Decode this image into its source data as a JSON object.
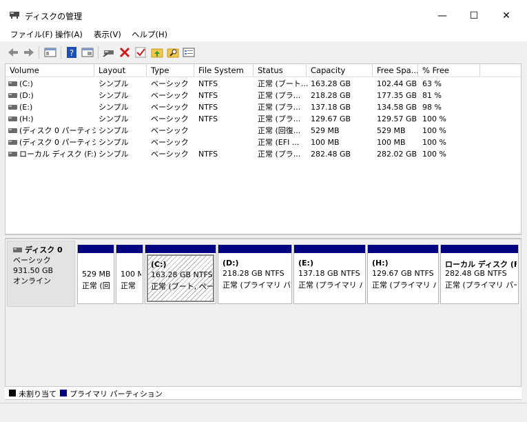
{
  "window": {
    "title": "ディスクの管理",
    "controls": {
      "minimize": "—",
      "maximize": "☐",
      "close": "✕"
    }
  },
  "menu": [
    "ファイル(F)",
    "操作(A)",
    "表示(V)",
    "ヘルプ(H)"
  ],
  "toolbar": {
    "icons": [
      "back-arrow-icon",
      "forward-arrow-icon",
      "console-tree-icon",
      "help-icon",
      "properties-icon",
      "connect-icon",
      "delete-icon",
      "check-icon",
      "folder-up-icon",
      "search-icon",
      "list-icon"
    ]
  },
  "columns": [
    "Volume",
    "Layout",
    "Type",
    "File System",
    "Status",
    "Capacity",
    "Free Spa...",
    "% Free"
  ],
  "volumes": [
    {
      "volume": "(C:)",
      "layout": "シンプル",
      "type": "ベーシック",
      "fs": "NTFS",
      "status": "正常 (ブート...",
      "capacity": "163.28 GB",
      "free": "102.44 GB",
      "pct": "63 %"
    },
    {
      "volume": "(D:)",
      "layout": "シンプル",
      "type": "ベーシック",
      "fs": "NTFS",
      "status": "正常 (プラ...",
      "capacity": "218.28 GB",
      "free": "177.35 GB",
      "pct": "81 %"
    },
    {
      "volume": "(E:)",
      "layout": "シンプル",
      "type": "ベーシック",
      "fs": "NTFS",
      "status": "正常 (プラ...",
      "capacity": "137.18 GB",
      "free": "134.58 GB",
      "pct": "98 %"
    },
    {
      "volume": "(H:)",
      "layout": "シンプル",
      "type": "ベーシック",
      "fs": "NTFS",
      "status": "正常 (プラ...",
      "capacity": "129.67 GB",
      "free": "129.57 GB",
      "pct": "100 %"
    },
    {
      "volume": "(ディスク 0 パーティシ...",
      "layout": "シンプル",
      "type": "ベーシック",
      "fs": "",
      "status": "正常 (回復...",
      "capacity": "529 MB",
      "free": "529 MB",
      "pct": "100 %"
    },
    {
      "volume": "(ディスク 0 パーティシ...",
      "layout": "シンプル",
      "type": "ベーシック",
      "fs": "",
      "status": "正常 (EFI ...",
      "capacity": "100 MB",
      "free": "100 MB",
      "pct": "100 %"
    },
    {
      "volume": "ローカル ディスク (F:)",
      "layout": "シンプル",
      "type": "ベーシック",
      "fs": "NTFS",
      "status": "正常 (プラ...",
      "capacity": "282.48 GB",
      "free": "282.02 GB",
      "pct": "100 %"
    }
  ],
  "disk": {
    "name": "ディスク 0",
    "type": "ベーシック",
    "size": "931.50 GB",
    "state": "オンライン"
  },
  "partitions": [
    {
      "title": "",
      "size": "529 MB",
      "status": "正常 (回"
    },
    {
      "title": "",
      "size": "100 M",
      "status": "正常"
    },
    {
      "title": "(C:)",
      "size": "163.28 GB NTFS",
      "status": "正常 (ブート, ページ"
    },
    {
      "title": "(D:)",
      "size": "218.28 GB NTFS",
      "status": "正常 (プライマリ パー"
    },
    {
      "title": "(E:)",
      "size": "137.18 GB NTFS",
      "status": "正常 (プライマリ パ-"
    },
    {
      "title": "(H:)",
      "size": "129.67 GB NTFS",
      "status": "正常 (プライマリ パ-"
    },
    {
      "title": "ローカル ディスク  (F:)",
      "size": "282.48 GB NTFS",
      "status": "正常 (プライマリ パーテ"
    }
  ],
  "legend": {
    "unallocated": "未割り当て",
    "primary": "プライマリ パーティション"
  },
  "colors": {
    "primary": "#000080",
    "unallocated": "#000000"
  }
}
